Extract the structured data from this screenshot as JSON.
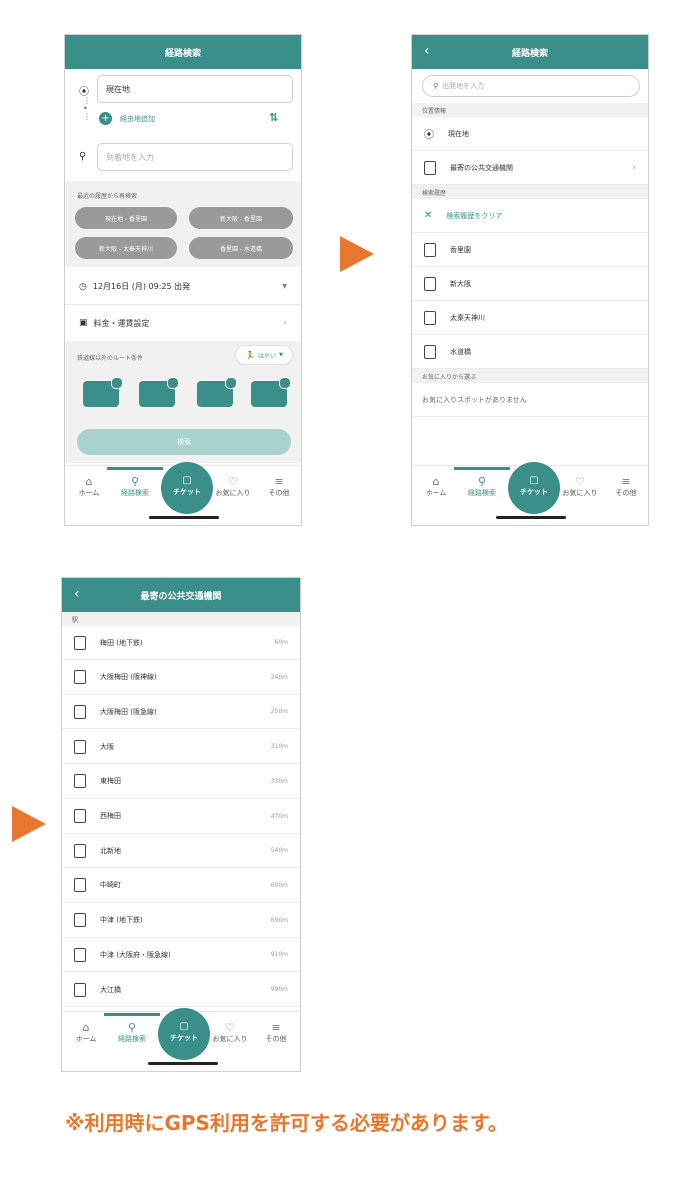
{
  "colors": {
    "accent": "#3a8f8b",
    "arrow": "#e8772e",
    "note": "#e8772e"
  },
  "screen1": {
    "title": "経路検索",
    "origin_value": "現在地",
    "via_label": "経由地追加",
    "dest_placeholder": "到着地を入力",
    "recent_label": "最近の履歴から再検索",
    "recent": [
      "現在地 - 香里園",
      "新大阪 - 香里園",
      "新大阪 - 太秦天神川",
      "香里園 - 水道橋"
    ],
    "datetime": "12月16日 (月) 09:25 出発",
    "fare_setting": "料金・運賃設定",
    "route_cond_label": "鉄道線以外のルート条件",
    "speed": "はやい",
    "search_button": "検索"
  },
  "screen2": {
    "title": "経路検索",
    "search_placeholder": "出発地を入力",
    "section_location": "位置情報",
    "current": "現在地",
    "nearest": "最寄の公共交通機関",
    "section_history": "検索履歴",
    "clear_history": "検索履歴をクリア",
    "history": [
      "香里園",
      "新大阪",
      "太秦天神川",
      "水道橋"
    ],
    "section_fav": "お気に入りから選ぶ",
    "no_fav": "お気に入りスポットがありません"
  },
  "screen3": {
    "title": "最寄の公共交通機関",
    "group": "駅",
    "stations": [
      {
        "name": "梅田 (地下鉄)",
        "dist": "60m"
      },
      {
        "name": "大阪梅田 (阪神線)",
        "dist": "240m"
      },
      {
        "name": "大阪梅田 (阪急線)",
        "dist": "250m"
      },
      {
        "name": "大阪",
        "dist": "310m"
      },
      {
        "name": "東梅田",
        "dist": "330m"
      },
      {
        "name": "西梅田",
        "dist": "470m"
      },
      {
        "name": "北新地",
        "dist": "540m"
      },
      {
        "name": "中崎町",
        "dist": "600m"
      },
      {
        "name": "中津 (地下鉄)",
        "dist": "690m"
      },
      {
        "name": "中津 (大阪府・阪急線)",
        "dist": "910m"
      },
      {
        "name": "大江橋",
        "dist": "990m"
      }
    ]
  },
  "tabs": {
    "home": "ホーム",
    "route": "経路検索",
    "ticket": "チケット",
    "fav": "お気に入り",
    "other": "その他"
  },
  "note": "※利用時にGPS利用を許可する必要があります。"
}
